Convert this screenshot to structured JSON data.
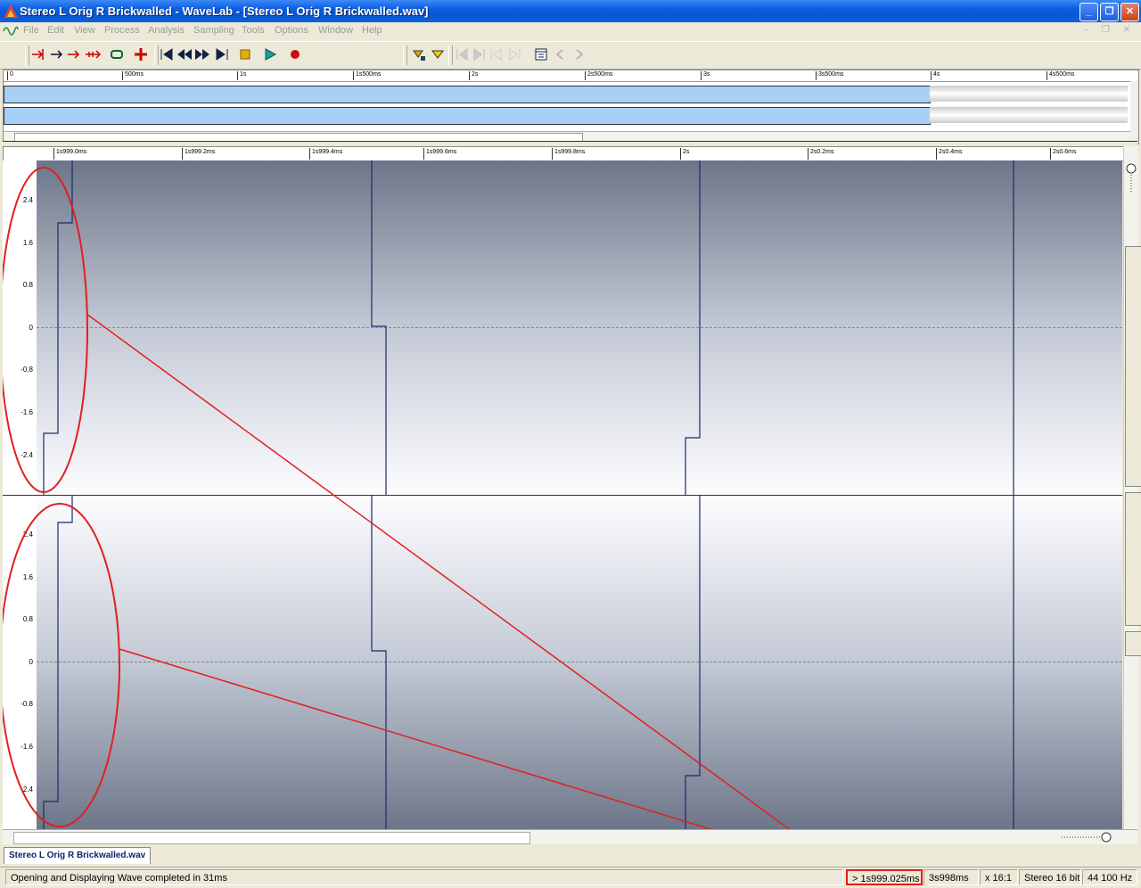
{
  "window": {
    "title": "Stereo L Orig R Brickwalled - WaveLab - [Stereo L Orig R Brickwalled.wav]",
    "minimize_glyph": "_",
    "restore_glyph": "❐",
    "close_glyph": "✕"
  },
  "menu": {
    "items": [
      "File",
      "Edit",
      "View",
      "Process",
      "Analysis",
      "Sampling",
      "Tools",
      "Options",
      "Window",
      "Help"
    ],
    "mdi_controls": "– ❐ ✕"
  },
  "overview": {
    "ruler_labels": [
      "0",
      "500ms",
      "1s",
      "1s500ms",
      "2s",
      "2s500ms",
      "3s",
      "3s500ms",
      "4s",
      "4s500ms"
    ]
  },
  "main_ruler": {
    "labels": [
      "1s999.0ms",
      "1s999.2ms",
      "1s999.4ms",
      "1s999.6ms",
      "1s999.8ms",
      "2s",
      "2s0.2ms",
      "2s0.4ms",
      "2s0.6ms"
    ]
  },
  "y_axis": {
    "labels": [
      "2.4",
      "1.6",
      "0.8",
      "0",
      "-0.8",
      "-1.6",
      "-2.4"
    ]
  },
  "document_tab": {
    "label": "Stereo L Orig R Brickwalled.wav"
  },
  "status": {
    "message": "Opening and Displaying Wave completed in 31ms",
    "cursor_position": "> 1s999.025ms",
    "length": "3s998ms",
    "zoom": "x 16:1",
    "format": "Stereo 16 bit",
    "sample_rate": "44 100 Hz"
  },
  "colors": {
    "annotation": "#e02020",
    "waveform": "#1a2a6c",
    "overview_fill": "#a8cff5"
  }
}
